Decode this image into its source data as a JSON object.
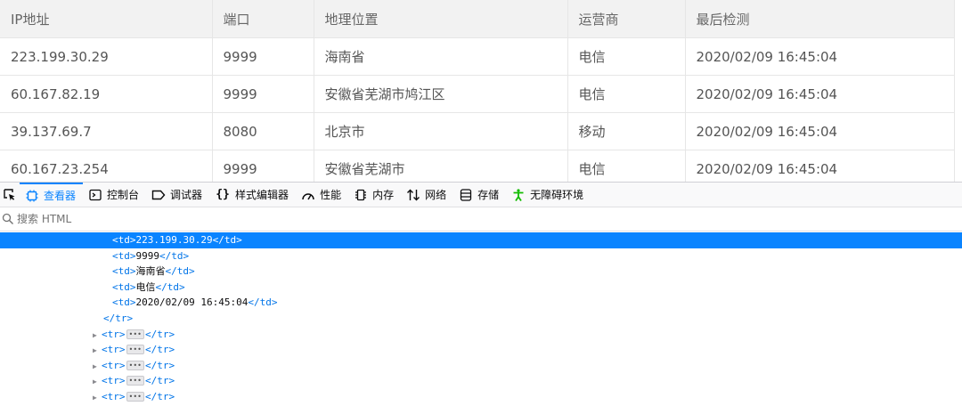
{
  "table": {
    "headers": [
      "IP地址",
      "端口",
      "地理位置",
      "运营商",
      "最后检测"
    ],
    "rows": [
      [
        "223.199.30.29",
        "9999",
        "海南省",
        "电信",
        "2020/02/09 16:45:04"
      ],
      [
        "60.167.82.19",
        "9999",
        "安徽省芜湖市鸠江区",
        "电信",
        "2020/02/09 16:45:04"
      ],
      [
        "39.137.69.7",
        "8080",
        "北京市",
        "移动",
        "2020/02/09 16:45:04"
      ],
      [
        "60.167.23.254",
        "9999",
        "安徽省芜湖市",
        "电信",
        "2020/02/09 16:45:04"
      ]
    ]
  },
  "devtools": {
    "tabs": [
      {
        "label": "查看器",
        "icon": "inspector-icon",
        "active": true
      },
      {
        "label": "控制台",
        "icon": "console-icon"
      },
      {
        "label": "调试器",
        "icon": "debugger-icon"
      },
      {
        "label": "样式编辑器",
        "icon": "style-editor-icon"
      },
      {
        "label": "性能",
        "icon": "performance-icon"
      },
      {
        "label": "内存",
        "icon": "memory-icon"
      },
      {
        "label": "网络",
        "icon": "network-icon"
      },
      {
        "label": "存储",
        "icon": "storage-icon"
      },
      {
        "label": "无障碍环境",
        "icon": "accessibility-icon"
      }
    ],
    "search_placeholder": "搜索 HTML",
    "markup": {
      "td_nodes": [
        "223.199.30.29",
        "9999",
        "海南省",
        "电信",
        "2020/02/09 16:45:04"
      ],
      "close_tr": "</tr>",
      "collapsed_tr_count": 5
    },
    "colors": {
      "accent": "#0a84ff",
      "tag": "#0074e8",
      "accessibility_green": "#12bc00"
    }
  }
}
